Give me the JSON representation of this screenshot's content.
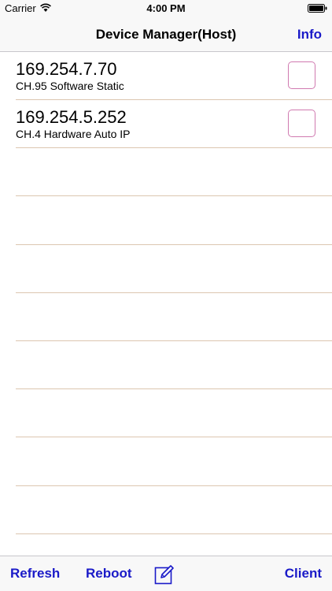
{
  "status_bar": {
    "carrier": "Carrier",
    "time": "4:00 PM",
    "wifi_icon": "wifi-icon",
    "battery_icon": "battery-icon"
  },
  "nav": {
    "title": "Device Manager(Host)",
    "info_label": "Info"
  },
  "devices": [
    {
      "ip": "169.254.7.70",
      "description": "CH.95 Software Static",
      "checked": false
    },
    {
      "ip": "169.254.5.252",
      "description": "CH.4 Hardware Auto IP",
      "checked": false
    }
  ],
  "empty_rows": 8,
  "toolbar": {
    "refresh_label": "Refresh",
    "reboot_label": "Reboot",
    "compose_icon": "compose-icon",
    "client_label": "Client"
  },
  "colors": {
    "accent": "#1a1ac8",
    "separator": "#dcc6b0",
    "checkbox_border": "#d07ab0"
  }
}
